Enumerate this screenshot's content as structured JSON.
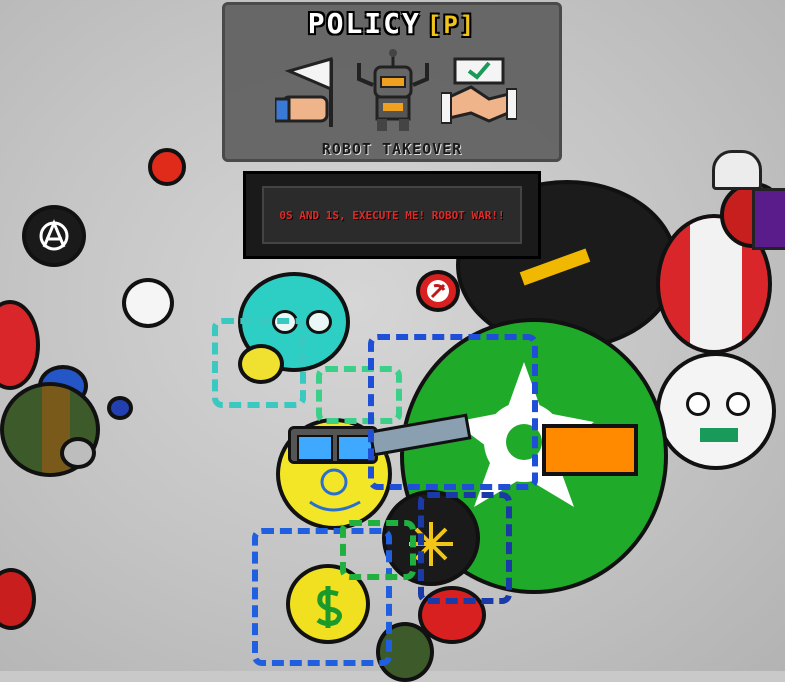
{
  "policy": {
    "title": "POLICY",
    "hotkey": "[P]",
    "selected_policy": "ROBOT TAKEOVER",
    "icons": [
      "surrender-flag-icon",
      "robot-icon",
      "handshake-agreement-icon"
    ]
  },
  "event": {
    "message": "0S AND 1S, EXECUTE ME! ROBOT WAR!!"
  },
  "colors": {
    "accent_yellow": "#f0c419",
    "event_red": "#e02a2a",
    "green_ball": "#1faa2a",
    "background": "#c9c9c9"
  }
}
